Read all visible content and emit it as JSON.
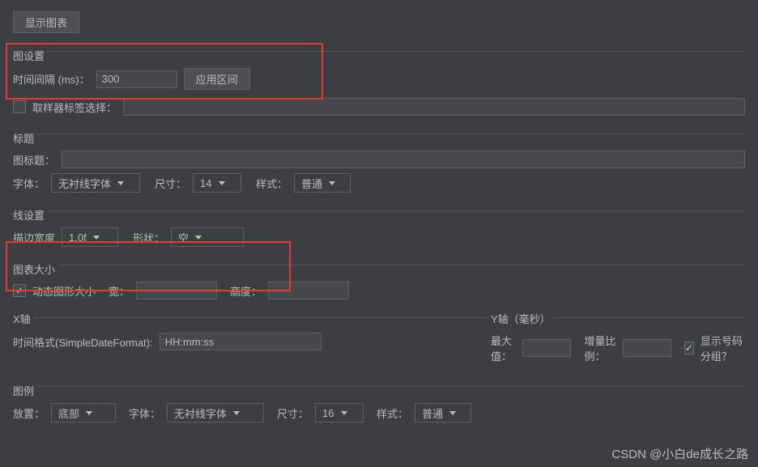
{
  "top_button": "显示图表",
  "graph_settings": {
    "legend": "图设置",
    "interval_label": "时间间隔 (ms)：",
    "interval_value": "300",
    "apply_btn": "应用区间"
  },
  "sampler": {
    "label": "取样器标签选择："
  },
  "title_section": {
    "legend": "标题",
    "title_label": "图标题：",
    "title_value": "",
    "font_label": "字体：",
    "font_value": "无衬线字体",
    "size_label": "尺寸：",
    "size_value": "14",
    "style_label": "样式：",
    "style_value": "普通"
  },
  "line_section": {
    "legend": "线设置",
    "stroke_label": "描边宽度",
    "stroke_value": "1.0f",
    "shape_label": "形状：",
    "shape_value": "空"
  },
  "chart_size": {
    "legend": "图表大小",
    "dynamic_label": "动态图形大小",
    "width_label": "宽：",
    "width_value": "",
    "height_label": "高度：",
    "height_value": ""
  },
  "x_axis": {
    "legend": "X轴",
    "format_label": "时间格式(SimpleDateFormat):",
    "format_value": "HH:mm:ss"
  },
  "y_axis": {
    "legend": "Y轴（毫秒）",
    "max_label": "最大值：",
    "max_value": "",
    "inc_label": "增量比例：",
    "inc_value": "",
    "show_group_label": "显示号码分组？"
  },
  "legend_section": {
    "legend": "图例",
    "placement_label": "放置：",
    "placement_value": "底部",
    "font_label": "字体：",
    "font_value": "无衬线字体",
    "size_label": "尺寸：",
    "size_value": "16",
    "style_label": "样式：",
    "style_value": "普通"
  },
  "watermark": "CSDN @小白de成长之路"
}
